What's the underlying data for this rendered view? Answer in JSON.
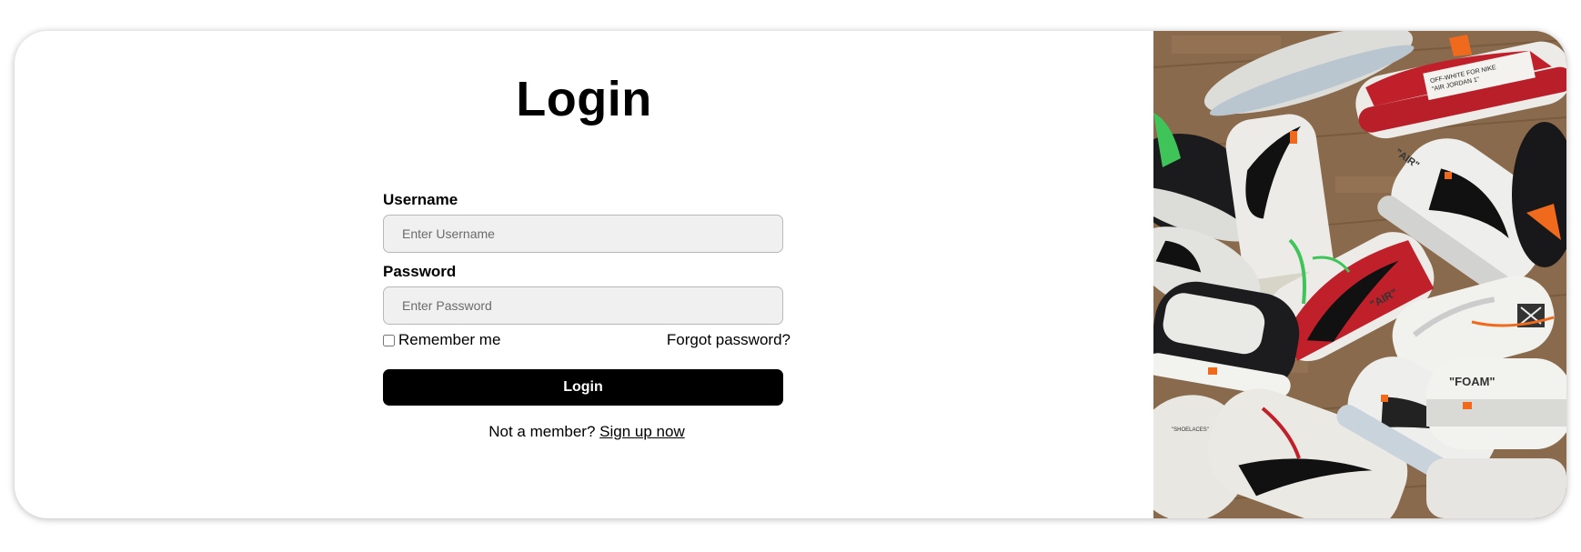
{
  "login": {
    "title": "Login",
    "username_label": "Username",
    "username_placeholder": "Enter Username",
    "password_label": "Password",
    "password_placeholder": "Enter Password",
    "remember_label": "Remember me",
    "forgot_label": "Forgot password?",
    "submit_label": "Login",
    "signup_prompt": "Not a member?",
    "signup_link": "Sign up now"
  },
  "hero_image": {
    "subject": "pile of sneakers on wooden floor",
    "colors": {
      "floor": "#8a6a4c",
      "sneaker_white": "#ecebe7",
      "sneaker_red": "#c0202a",
      "swoosh": "#111111",
      "accent_orange": "#f06a1e",
      "accent_green": "#3fc45a"
    }
  },
  "colors": {
    "button_bg": "#000000",
    "button_text": "#ffffff",
    "input_bg": "#f0f0f0"
  }
}
